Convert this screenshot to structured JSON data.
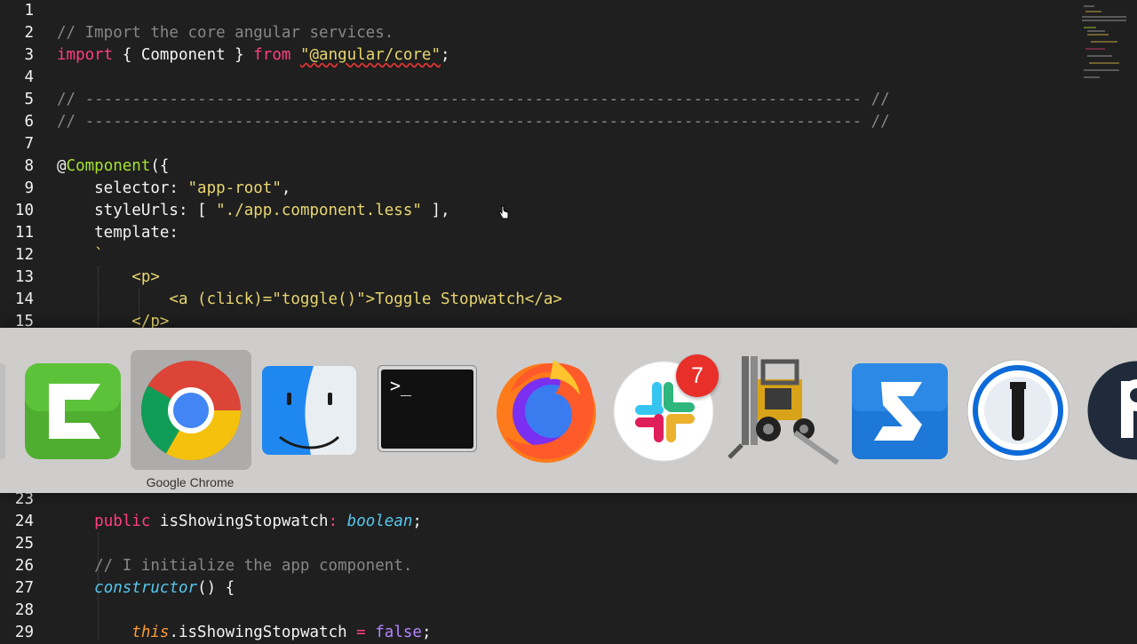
{
  "editor": {
    "lines": [
      {
        "n": "1",
        "parts": []
      },
      {
        "n": "2",
        "parts": [
          {
            "t": "// Import the core angular services.",
            "c": "com"
          }
        ]
      },
      {
        "n": "3",
        "parts": [
          {
            "t": "import",
            "c": "kw"
          },
          {
            "t": " { Component } ",
            "c": ""
          },
          {
            "t": "from",
            "c": "kw"
          },
          {
            "t": " ",
            "c": ""
          },
          {
            "t": "\"@angular/core\"",
            "c": "str err"
          },
          {
            "t": ";",
            "c": ""
          }
        ]
      },
      {
        "n": "4",
        "parts": []
      },
      {
        "n": "5",
        "parts": [
          {
            "t": "// ----------------------------------------------------------------------------------- //",
            "c": "com"
          }
        ]
      },
      {
        "n": "6",
        "parts": [
          {
            "t": "// ----------------------------------------------------------------------------------- //",
            "c": "com"
          }
        ]
      },
      {
        "n": "7",
        "parts": []
      },
      {
        "n": "8",
        "parts": [
          {
            "t": "@",
            "c": ""
          },
          {
            "t": "Component",
            "c": "fn"
          },
          {
            "t": "({",
            "c": ""
          }
        ]
      },
      {
        "n": "9",
        "parts": [
          {
            "t": "    selector: ",
            "c": ""
          },
          {
            "t": "\"app-root\"",
            "c": "str"
          },
          {
            "t": ",",
            "c": ""
          }
        ]
      },
      {
        "n": "10",
        "parts": [
          {
            "t": "    styleUrls: [ ",
            "c": ""
          },
          {
            "t": "\"./app.component.less\"",
            "c": "str"
          },
          {
            "t": " ],",
            "c": ""
          }
        ]
      },
      {
        "n": "11",
        "parts": [
          {
            "t": "    template:",
            "c": ""
          }
        ]
      },
      {
        "n": "12",
        "parts": [
          {
            "t": "    `",
            "c": "tpl"
          }
        ]
      },
      {
        "n": "13",
        "parts": [
          {
            "t": "        <p>",
            "c": "tpl"
          }
        ]
      },
      {
        "n": "14",
        "parts": [
          {
            "t": "            <a (click)=\"toggle()\">Toggle Stopwatch</a>",
            "c": "tpl"
          }
        ]
      },
      {
        "n": "15",
        "parts": [
          {
            "t": "        </p>",
            "c": "tpl"
          }
        ]
      },
      {
        "n": "23",
        "parts": []
      },
      {
        "n": "24",
        "parts": [
          {
            "t": "    ",
            "c": ""
          },
          {
            "t": "public",
            "c": "kw"
          },
          {
            "t": " isShowingStopwatch",
            "c": ""
          },
          {
            "t": ":",
            "c": "kw"
          },
          {
            "t": " ",
            "c": ""
          },
          {
            "t": "boolean",
            "c": "type"
          },
          {
            "t": ";",
            "c": ""
          }
        ]
      },
      {
        "n": "25",
        "parts": []
      },
      {
        "n": "26",
        "parts": [
          {
            "t": "    // I initialize the app component.",
            "c": "com"
          }
        ]
      },
      {
        "n": "27",
        "parts": [
          {
            "t": "    ",
            "c": ""
          },
          {
            "t": "constructor",
            "c": "type"
          },
          {
            "t": "() {",
            "c": ""
          }
        ]
      },
      {
        "n": "28",
        "parts": []
      },
      {
        "n": "29",
        "parts": [
          {
            "t": "        ",
            "c": ""
          },
          {
            "t": "this",
            "c": "this"
          },
          {
            "t": ".isShowingStopwatch ",
            "c": ""
          },
          {
            "t": "=",
            "c": "kw"
          },
          {
            "t": " ",
            "c": ""
          },
          {
            "t": "false",
            "c": "bool"
          },
          {
            "t": ";",
            "c": ""
          }
        ]
      }
    ]
  },
  "app_switcher": {
    "selected_label": "Google Chrome",
    "apps": [
      {
        "name": "Camtasia",
        "icon": "camtasia-icon"
      },
      {
        "name": "Google Chrome",
        "icon": "chrome-icon"
      },
      {
        "name": "Finder",
        "icon": "finder-icon"
      },
      {
        "name": "Terminal",
        "icon": "terminal-icon"
      },
      {
        "name": "Firefox",
        "icon": "firefox-icon"
      },
      {
        "name": "Slack",
        "icon": "slack-icon"
      },
      {
        "name": "Transmit",
        "icon": "forklift-icon"
      },
      {
        "name": "Snagit",
        "icon": "snagit-icon"
      },
      {
        "name": "1Password",
        "icon": "1password-icon"
      },
      {
        "name": "Pocket Casts",
        "icon": "podcast-icon"
      }
    ],
    "slack_badge": "7"
  },
  "colors": {
    "keyword": "#ff3f7f",
    "string": "#e8d66f",
    "comment": "#868686",
    "function": "#a6e22e",
    "type": "#56c7ee",
    "this": "#fd9a34",
    "bool": "#b184ff"
  }
}
